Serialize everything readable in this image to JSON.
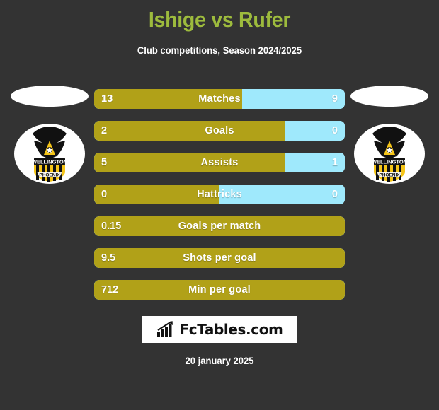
{
  "header": {
    "title": "Ishige vs Rufer",
    "subtitle": "Club competitions, Season 2024/2025",
    "title_color": "#9DBB3D"
  },
  "theme": {
    "background": "#333333",
    "gold": "#B1A118",
    "light_blue": "#9FE9FC",
    "text": "#ffffff"
  },
  "left_panel": {
    "player_photo": "player-photo-placeholder",
    "club_badge": "wellington-phoenix-badge",
    "club_name_line1": "WELLINGTON",
    "club_name_line2": "PHOENIX"
  },
  "right_panel": {
    "player_photo": "player-photo-placeholder",
    "club_badge": "wellington-phoenix-badge",
    "club_name_line1": "WELLINGTON",
    "club_name_line2": "PHOENIX"
  },
  "chart_data": {
    "type": "bar",
    "title": "Ishige vs Rufer",
    "subtitle": "Club competitions, Season 2024/2025",
    "orientation": "horizontal-diverging",
    "categories": [
      "Matches",
      "Goals",
      "Assists",
      "Hattricks",
      "Goals per match",
      "Shots per goal",
      "Min per goal"
    ],
    "series": [
      {
        "name": "Ishige",
        "color": "#B1A118",
        "values": [
          "13",
          "2",
          "5",
          "0",
          "0.15",
          "9.5",
          "712"
        ]
      },
      {
        "name": "Rufer",
        "color": "#9FE9FC",
        "values": [
          "9",
          "0",
          "1",
          "0",
          "",
          "",
          ""
        ]
      }
    ],
    "fill_percent_left": [
      59.1,
      76.0,
      76.0,
      50.0,
      100,
      100,
      100
    ],
    "legend_position": "none",
    "grid": false
  },
  "rows": [
    {
      "label": "Matches",
      "left": "13",
      "right": "9",
      "left_pct": 59.1,
      "split": true
    },
    {
      "label": "Goals",
      "left": "2",
      "right": "0",
      "left_pct": 76.0,
      "split": true
    },
    {
      "label": "Assists",
      "left": "5",
      "right": "1",
      "left_pct": 76.0,
      "split": true
    },
    {
      "label": "Hattricks",
      "left": "0",
      "right": "0",
      "left_pct": 50.0,
      "split": true
    },
    {
      "label": "Goals per match",
      "left": "0.15",
      "right": "",
      "left_pct": 100,
      "split": false
    },
    {
      "label": "Shots per goal",
      "left": "9.5",
      "right": "",
      "left_pct": 100,
      "split": false
    },
    {
      "label": "Min per goal",
      "left": "712",
      "right": "",
      "left_pct": 100,
      "split": false
    }
  ],
  "logo": {
    "text": "FcTables.com",
    "icon": "bar-chart-arrow-icon"
  },
  "footer": {
    "date": "20 january 2025"
  }
}
